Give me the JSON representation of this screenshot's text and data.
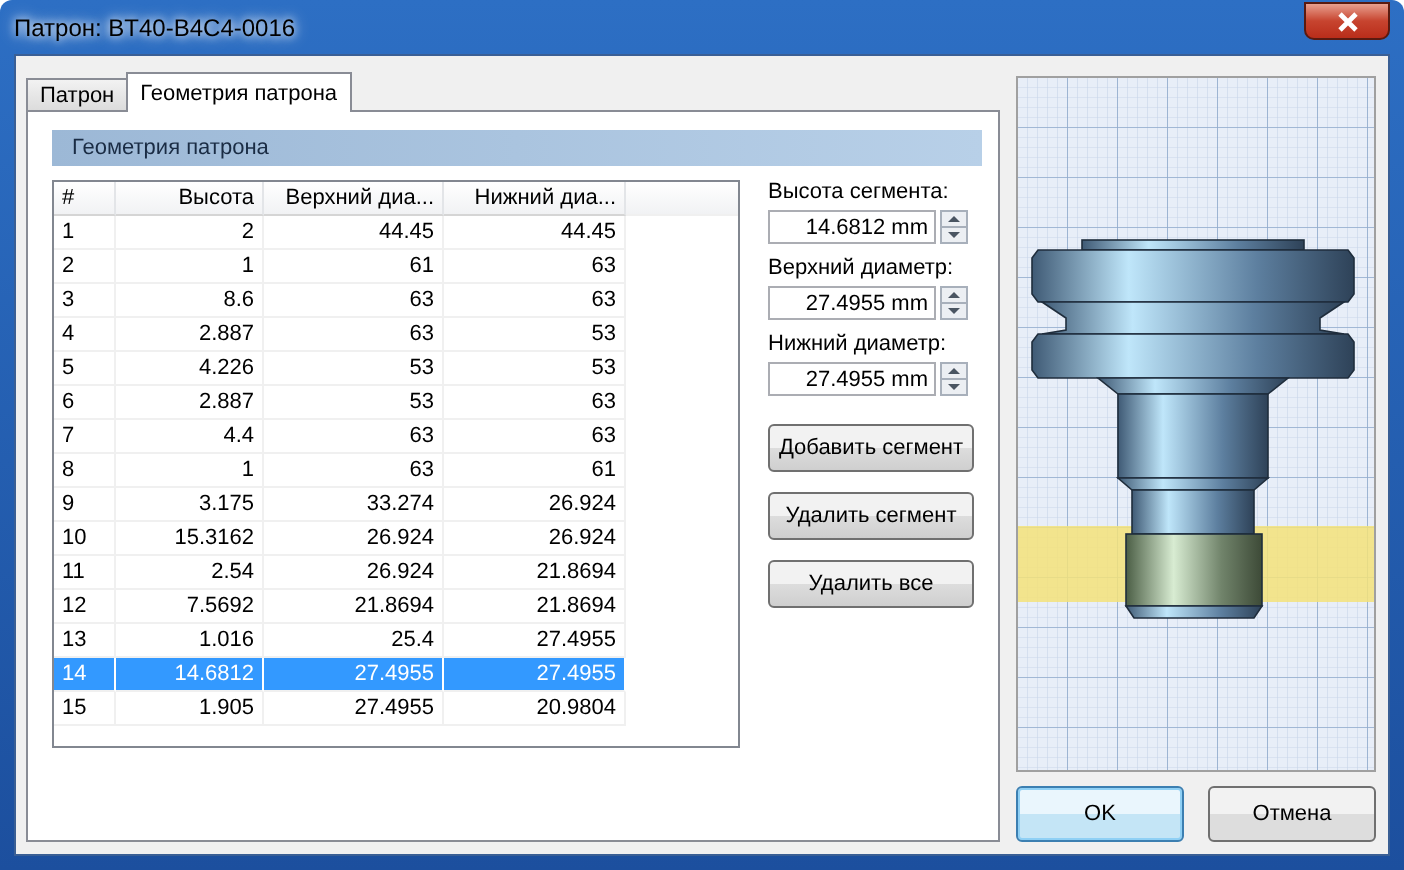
{
  "window": {
    "title": "Патрон: BT40-B4C4-0016"
  },
  "tabs": [
    {
      "label": "Патрон",
      "selected": false
    },
    {
      "label": "Геометрия патрона",
      "selected": true
    }
  ],
  "section_title": "Геометрия патрона",
  "table": {
    "columns": [
      "#",
      "Высота",
      "Верхний диа...",
      "Нижний диа..."
    ],
    "rows": [
      {
        "cells": [
          "1",
          "2",
          "44.45",
          "44.45"
        ],
        "selected": false
      },
      {
        "cells": [
          "2",
          "1",
          "61",
          "63"
        ],
        "selected": false
      },
      {
        "cells": [
          "3",
          "8.6",
          "63",
          "63"
        ],
        "selected": false
      },
      {
        "cells": [
          "4",
          "2.887",
          "63",
          "53"
        ],
        "selected": false
      },
      {
        "cells": [
          "5",
          "4.226",
          "53",
          "53"
        ],
        "selected": false
      },
      {
        "cells": [
          "6",
          "2.887",
          "53",
          "63"
        ],
        "selected": false
      },
      {
        "cells": [
          "7",
          "4.4",
          "63",
          "63"
        ],
        "selected": false
      },
      {
        "cells": [
          "8",
          "1",
          "63",
          "61"
        ],
        "selected": false
      },
      {
        "cells": [
          "9",
          "3.175",
          "33.274",
          "26.924"
        ],
        "selected": false
      },
      {
        "cells": [
          "10",
          "15.3162",
          "26.924",
          "26.924"
        ],
        "selected": false
      },
      {
        "cells": [
          "11",
          "2.54",
          "26.924",
          "21.8694"
        ],
        "selected": false
      },
      {
        "cells": [
          "12",
          "7.5692",
          "21.8694",
          "21.8694"
        ],
        "selected": false
      },
      {
        "cells": [
          "13",
          "1.016",
          "25.4",
          "27.4955"
        ],
        "selected": false
      },
      {
        "cells": [
          "14",
          "14.6812",
          "27.4955",
          "27.4955"
        ],
        "selected": true
      },
      {
        "cells": [
          "15",
          "1.905",
          "27.4955",
          "20.9804"
        ],
        "selected": false
      }
    ]
  },
  "fields": [
    {
      "label": "Высота сегмента:",
      "value": "14.6812 mm"
    },
    {
      "label": "Верхний диаметр:",
      "value": "27.4955 mm"
    },
    {
      "label": "Нижний диаметр:",
      "value": "27.4955 mm"
    }
  ],
  "segment_buttons": [
    "Добавить сегмент",
    "Удалить сегмент",
    "Удалить все"
  ],
  "dialog_buttons": [
    {
      "label": "OK",
      "default": true
    },
    {
      "label": "Отмена",
      "default": false
    }
  ]
}
